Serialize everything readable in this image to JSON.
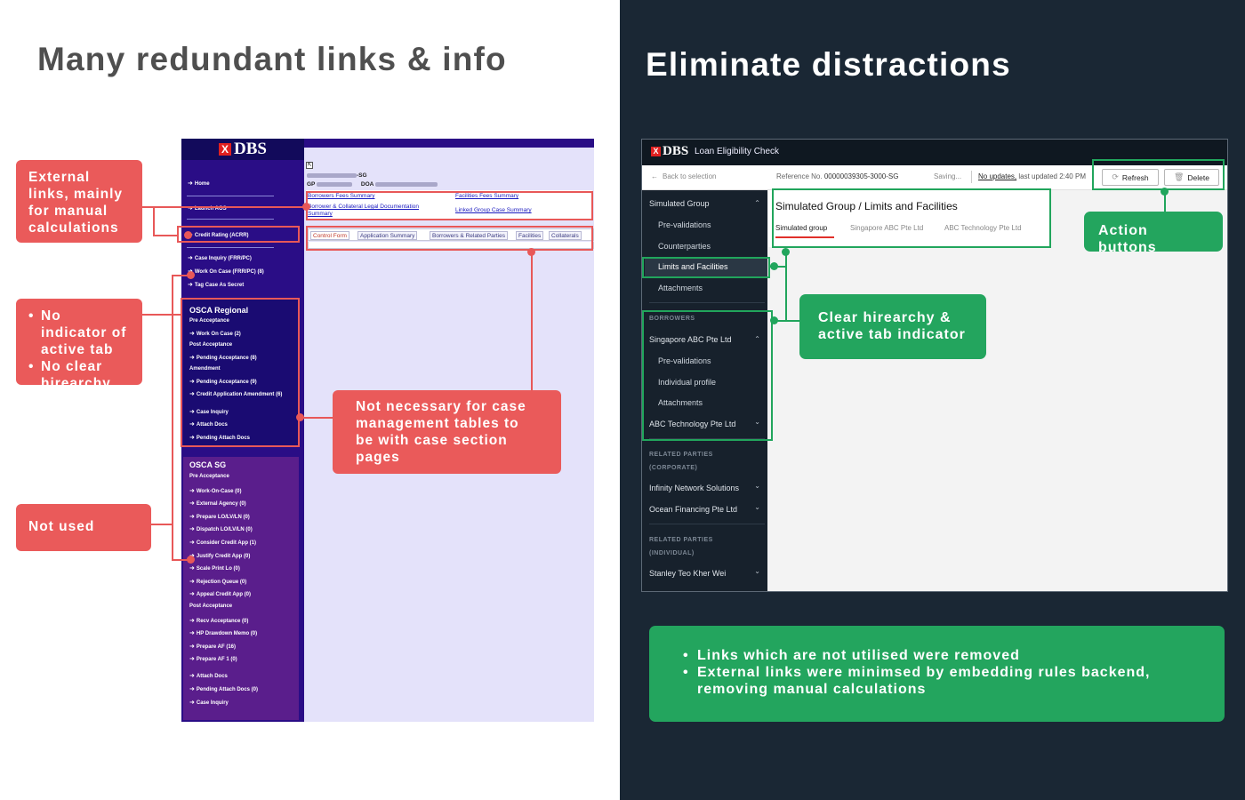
{
  "left_panel": {
    "title": "Many redundant links & info",
    "old_ui": {
      "logo": "DBS",
      "logo_mark": "X",
      "links": {
        "home": "Home",
        "launch_aos": "Launch AOS",
        "credit_rating": "Credit Rating (ACRR)",
        "case_inquiry": "Case Inquiry (FRR/PC)",
        "work_on_case": "Work On Case (FRR/PC) (8)",
        "tag_case": "Tag Case As Secret"
      },
      "regional": {
        "heading": "OSCA Regional",
        "pre_acceptance": "Pre Acceptance",
        "work_on_case": "Work On Case (2)",
        "post_acceptance": "Post Acceptance",
        "pending_acceptance_1": "Pending Acceptance (8)",
        "amendment": "Amendment",
        "pending_acceptance_2": "Pending Acceptance (9)",
        "credit_app_amendment": "Credit Application Amendment (6)",
        "case_inquiry": "Case Inquiry",
        "attach_docs": "Attach Docs",
        "pending_attach_docs": "Pending Attach Docs"
      },
      "sg": {
        "heading": "OSCA SG",
        "items": [
          {
            "text": "Pre Acceptance",
            "kind": "sub"
          },
          {
            "text": "Work-On-Case (0)",
            "kind": "link"
          },
          {
            "text": "External Agency (0)",
            "kind": "link"
          },
          {
            "text": "Prepare LO/LV/LN (0)",
            "kind": "link"
          },
          {
            "text": "Dispatch LO/LV/LN (0)",
            "kind": "link"
          },
          {
            "text": "Consider Credit App (1)",
            "kind": "link"
          },
          {
            "text": "Justify Credit App (0)",
            "kind": "link"
          },
          {
            "text": "Scale Print Lo (0)",
            "kind": "link"
          },
          {
            "text": "Rejection Queue (0)",
            "kind": "link"
          },
          {
            "text": "Appeal Credit App (0)",
            "kind": "link"
          },
          {
            "text": "Post Acceptance",
            "kind": "sub"
          },
          {
            "text": "Recv Acceptance (0)",
            "kind": "link"
          },
          {
            "text": "HP Drawdown Memo (0)",
            "kind": "link"
          },
          {
            "text": "Prepare AF (16)",
            "kind": "link"
          },
          {
            "text": "Prepare AF 1 (0)",
            "kind": "link"
          },
          {
            "text": "Attach Docs",
            "kind": "link"
          },
          {
            "text": "Pending Attach Docs (0)",
            "kind": "link"
          },
          {
            "text": "Case Inquiry",
            "kind": "link"
          }
        ]
      },
      "ref_suffix": "-SG",
      "gp_label": "GP",
      "doa_label": "DOA",
      "summary_links": {
        "borrowers_fees": "Borrowers Fees Summary",
        "borrower_collateral_1": "Borrower & Collateral Legal Documentation",
        "borrower_collateral_2": "Summary",
        "facilities_fees": "Facilities Fees Summary",
        "linked_group": "Linked Group Case Summary"
      },
      "tabs": [
        "Control Form",
        "Application Summary",
        "Borrowers & Related Parties",
        "Facilities",
        "Collaterals"
      ]
    },
    "callouts": {
      "external_links": "External links, mainly for manual calculations",
      "indicator_1": "No indicator of active tab",
      "indicator_2": "No clear hirearchy",
      "not_used": "Not used",
      "not_necessary": "Not necessary for case management tables to be with case section pages"
    }
  },
  "right_panel": {
    "title": "Eliminate distractions",
    "new_ui": {
      "logo": "DBS",
      "logo_mark": "X",
      "app_title": "Loan Eligibility Check",
      "back": "Back to selection",
      "ref_label": "Reference No.",
      "ref_value": "00000039305-3000-SG",
      "saving": "Saving...",
      "no_updates": "No updates,",
      "last_updated": "last updated 2:40 PM",
      "refresh": "Refresh",
      "delete": "Delete",
      "page_title": "Simulated Group / Limits and Facilities",
      "tabs": [
        "Simulated group",
        "Singapore ABC Pte Ltd",
        "ABC Technology Pte Ltd"
      ],
      "sidebar": {
        "simulated_group": "Simulated Group",
        "pre_validations": "Pre-validations",
        "counterparties": "Counterparties",
        "limits_facilities": "Limits and Facilities",
        "attachments": "Attachments",
        "borrowers_label": "BORROWERS",
        "singapore_abc": "Singapore ABC Pte Ltd",
        "pre_validations_2": "Pre-validations",
        "individual_profile": "Individual profile",
        "attachments_2": "Attachments",
        "abc_technology": "ABC Technology Pte Ltd",
        "related_corporate_1": "RELATED PARTIES",
        "related_corporate_2": "(CORPORATE)",
        "infinity": "Infinity Network Solutions",
        "ocean": "Ocean Financing Pte Ltd",
        "related_individual_1": "RELATED PARTIES",
        "related_individual_2": "(INDIVIDUAL)",
        "stanley": "Stanley Teo Kher Wei"
      }
    },
    "callouts": {
      "action_buttons": "Action buttons",
      "clear_hierarchy": "Clear hirearchy & active tab indicator"
    },
    "bottom_points": [
      "Links which are not utilised were removed",
      "External links were minimsed by embedding rules backend, removing manual calculations"
    ]
  },
  "colors": {
    "left_bg": "#ffffff",
    "right_bg": "#1a2734",
    "annotation_red": "#ea5a5a",
    "annotation_green": "#23a55e",
    "old_sidebar": "#2a0d86",
    "new_sidebar": "#17212c",
    "active_tab_underline": "#e0302a"
  }
}
